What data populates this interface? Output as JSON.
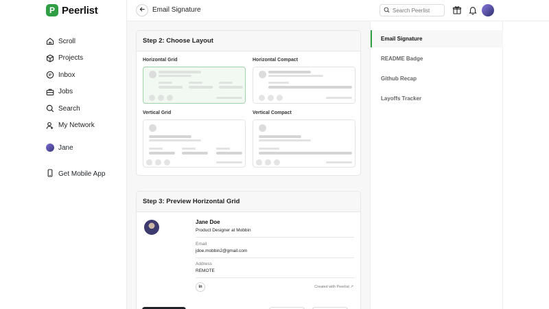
{
  "brand": {
    "logo_letter": "P",
    "name": "Peerlist",
    "accent": "#2f9e44"
  },
  "nav": {
    "items": [
      {
        "label": "Scroll",
        "icon": "home-icon"
      },
      {
        "label": "Projects",
        "icon": "cube-icon"
      },
      {
        "label": "Inbox",
        "icon": "chat-icon"
      },
      {
        "label": "Jobs",
        "icon": "briefcase-icon"
      },
      {
        "label": "Search",
        "icon": "search-icon"
      },
      {
        "label": "My Network",
        "icon": "network-icon"
      }
    ],
    "user": "Jane",
    "mobile_app": "Get Mobile App"
  },
  "header": {
    "title": "Email Signature",
    "search_placeholder": "Search Peerlist"
  },
  "step2": {
    "title": "Step 2: Choose Layout",
    "layouts": [
      "Horizontal Grid",
      "Horizontal Compact",
      "Vertical Grid",
      "Vertical Compact"
    ],
    "selected": "Horizontal Grid"
  },
  "step3": {
    "title": "Step 3: Preview Horizontal Grid",
    "name": "Jane Doe",
    "role": "Product Designer at Mobbin",
    "email_label": "Email",
    "email": "jdoe.mobbin2@gmail.com",
    "address_label": "Address",
    "address": "REMOTE",
    "social": "in",
    "credit": "Created with Peerlist ↗"
  },
  "right_nav": {
    "items": [
      "Email Signature",
      "README Badge",
      "Github Recap",
      "Layoffs Tracker"
    ],
    "active": "Email Signature"
  }
}
